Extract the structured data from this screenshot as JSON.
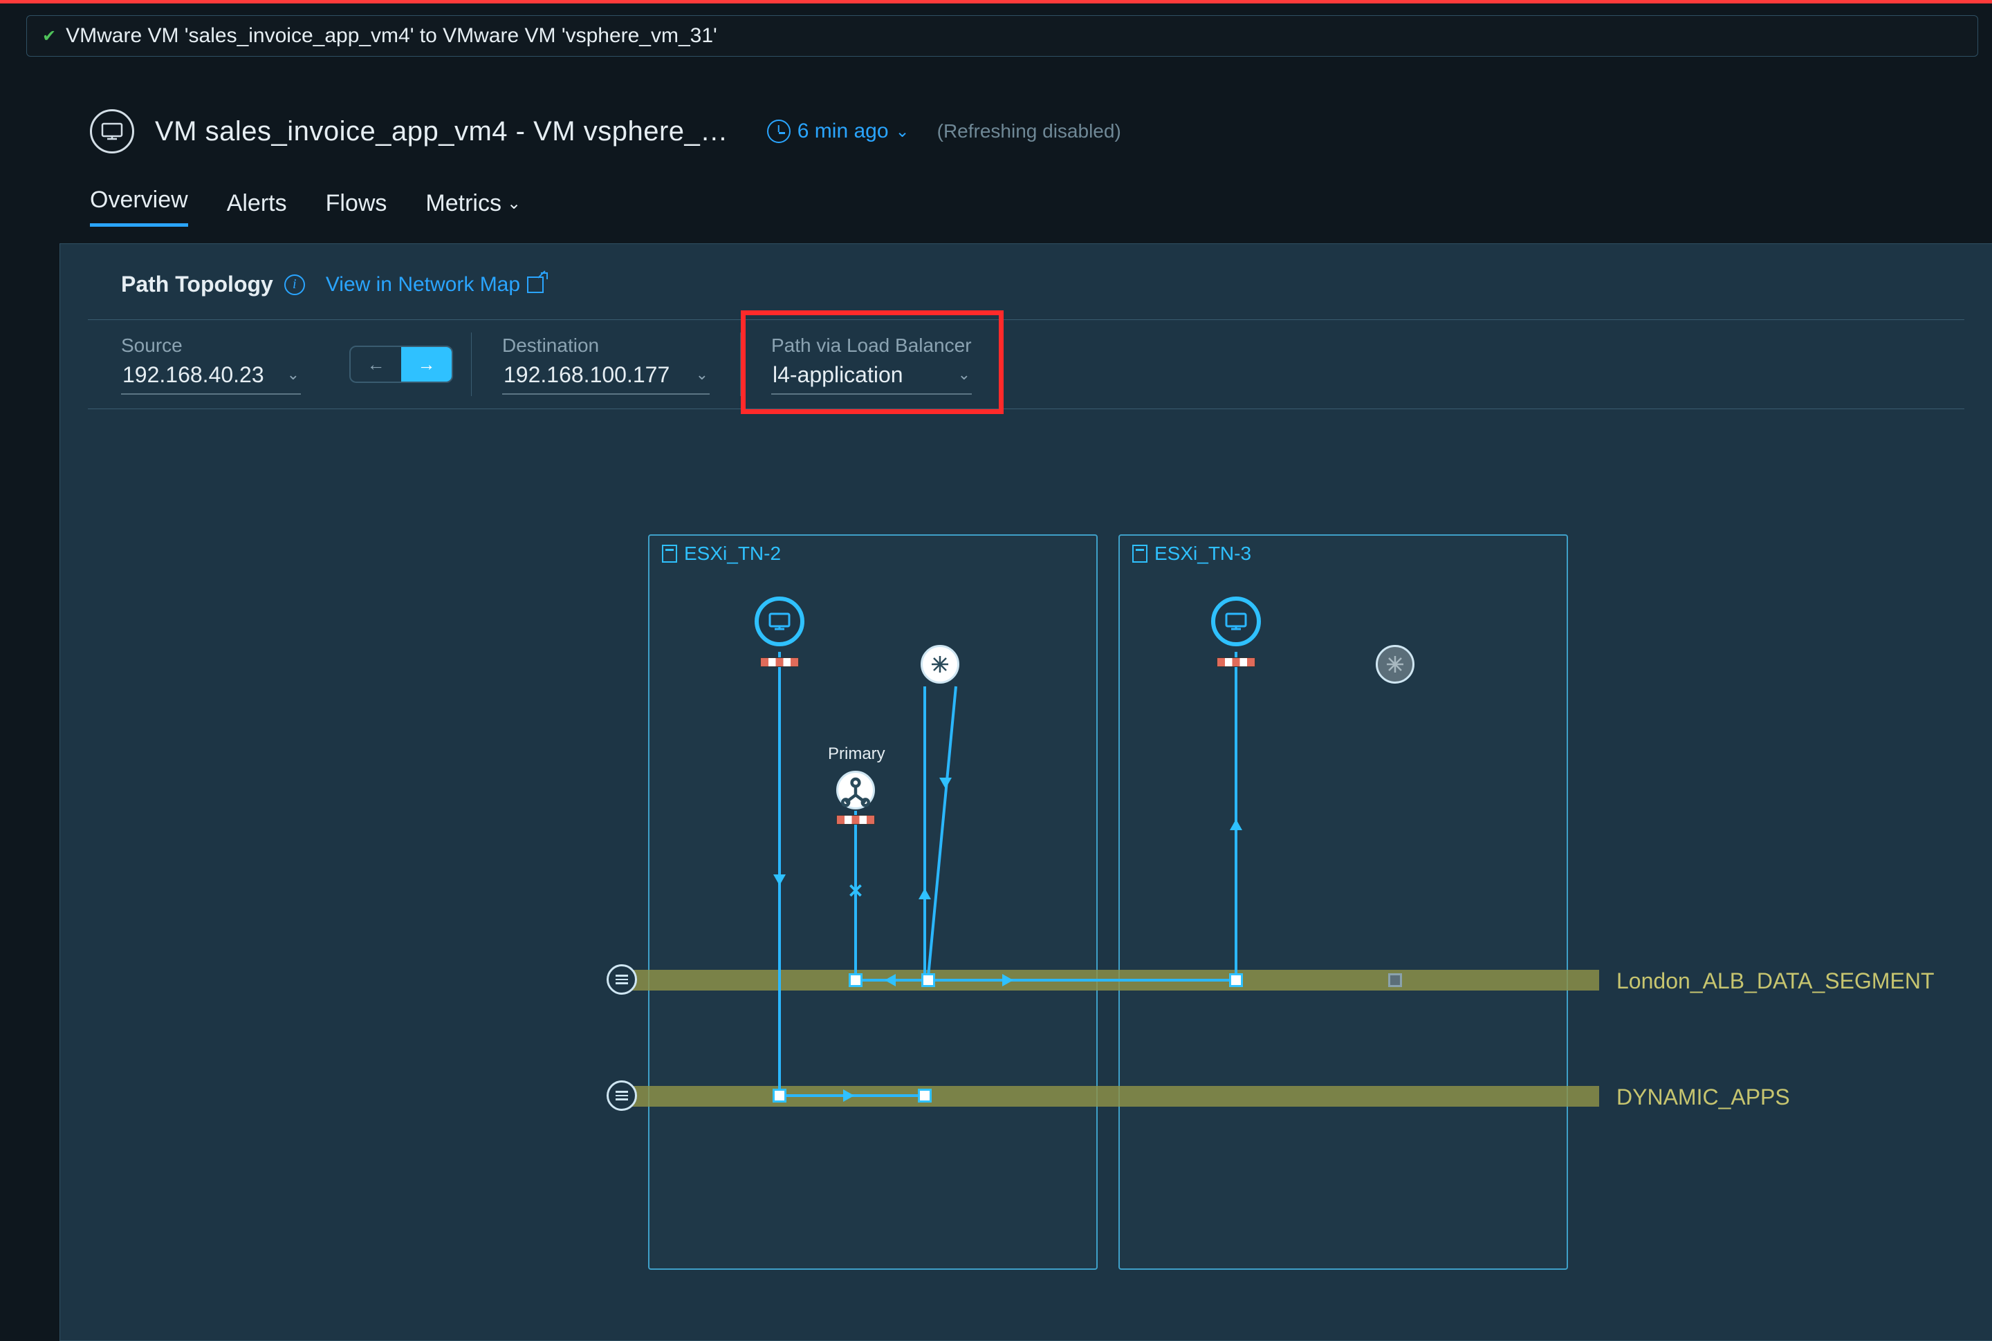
{
  "breadcrumb": "VMware VM 'sales_invoice_app_vm4' to VMware VM 'vsphere_vm_31'",
  "title": "VM sales_invoice_app_vm4 - VM vsphere_…",
  "time_ago": "6 min ago",
  "refresh_status": "(Refreshing  disabled)",
  "tabs": {
    "overview": "Overview",
    "alerts": "Alerts",
    "flows": "Flows",
    "metrics": "Metrics"
  },
  "panel": {
    "title": "Path Topology",
    "network_map_link": "View in Network Map"
  },
  "filters": {
    "source_label": "Source",
    "source_value": "192.168.40.23",
    "dest_label": "Destination",
    "dest_value": "192.168.100.177",
    "lb_label": "Path via Load Balancer",
    "lb_value": "l4-application"
  },
  "hosts": {
    "esxi2": "ESXi_TN-2",
    "esxi3": "ESXi_TN-3"
  },
  "node_labels": {
    "primary": "Primary"
  },
  "segments": {
    "seg1": "London_ALB_DATA_SEGMENT",
    "seg2": "DYNAMIC_APPS"
  },
  "icons": {
    "arrow_left": "←",
    "arrow_right": "→"
  }
}
